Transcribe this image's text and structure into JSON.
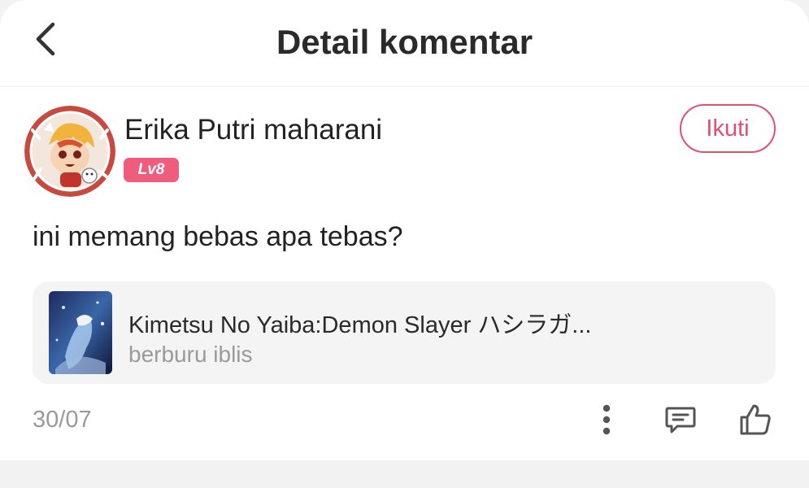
{
  "header": {
    "title": "Detail komentar",
    "back_icon": "chevron-left-icon"
  },
  "comment": {
    "username": "Erika Putri maharani",
    "level": "Lv8",
    "follow_label": "Ikuti",
    "text": "ini memang bebas apa tebas?",
    "date": "30/07"
  },
  "book": {
    "title": "Kimetsu No Yaiba:Demon Slayer ハシラガ...",
    "subtitle": "berburu iblis"
  },
  "actions": {
    "more_icon": "more-vertical-icon",
    "reply_icon": "comment-icon",
    "like_icon": "thumbs-up-icon"
  },
  "colors": {
    "accent": "#e3506e",
    "level_badge": "#f05c7e",
    "muted_text": "#9a9a9a",
    "card_bg": "#f4f4f4"
  }
}
